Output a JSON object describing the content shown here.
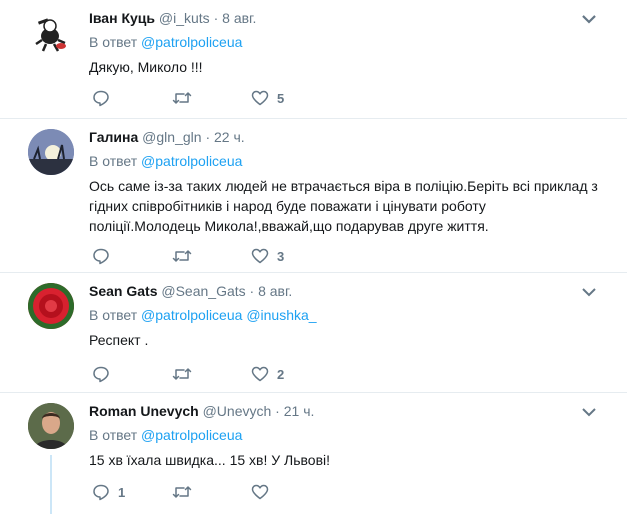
{
  "tweets": [
    {
      "name": "Іван Куць",
      "handle": "@i_kuts",
      "time": "8 авг.",
      "reply_prefix": "В ответ",
      "mentions": [
        "@patrolpoliceua"
      ],
      "lines": [
        "Дякую, Миколо !!!"
      ],
      "reply_count": "",
      "retweet_count": "",
      "like_count": "5"
    },
    {
      "name": "Галина",
      "handle": "@gln_gln",
      "time": "22 ч.",
      "reply_prefix": "В ответ",
      "mentions": [
        "@patrolpoliceua"
      ],
      "lines": [
        "Ось саме із-за таких людей не втрачається віра в поліцію.Беріть всі приклад з",
        "гідних співробітників і народ буде поважати і цінувати роботу",
        "поліції.Молодець Микола!,вважай,що подарував друге життя."
      ],
      "reply_count": "",
      "retweet_count": "",
      "like_count": "3"
    },
    {
      "name": "Sean Gats",
      "handle": "@Sean_Gats",
      "time": "8 авг.",
      "reply_prefix": "В ответ",
      "mentions": [
        "@patrolpoliceua",
        "@inushka_"
      ],
      "lines": [
        "Респект ."
      ],
      "reply_count": "",
      "retweet_count": "",
      "like_count": "2"
    },
    {
      "name": "Roman Unevych",
      "handle": "@Unevych",
      "time": "21 ч.",
      "reply_prefix": "В ответ",
      "mentions": [
        "@patrolpoliceua"
      ],
      "lines": [
        "15 хв їхала швидка... 15 хв! У Львові!"
      ],
      "reply_count": "1",
      "retweet_count": "",
      "like_count": ""
    }
  ],
  "colors": {
    "link": "#1da1f2",
    "secondary": "#657786",
    "divider": "#e6ecf0",
    "thread_line": "#cce6f7"
  },
  "icons": {
    "reply": "reply-icon",
    "retweet": "retweet-icon",
    "like": "heart-icon",
    "more": "chevron-down-icon"
  }
}
